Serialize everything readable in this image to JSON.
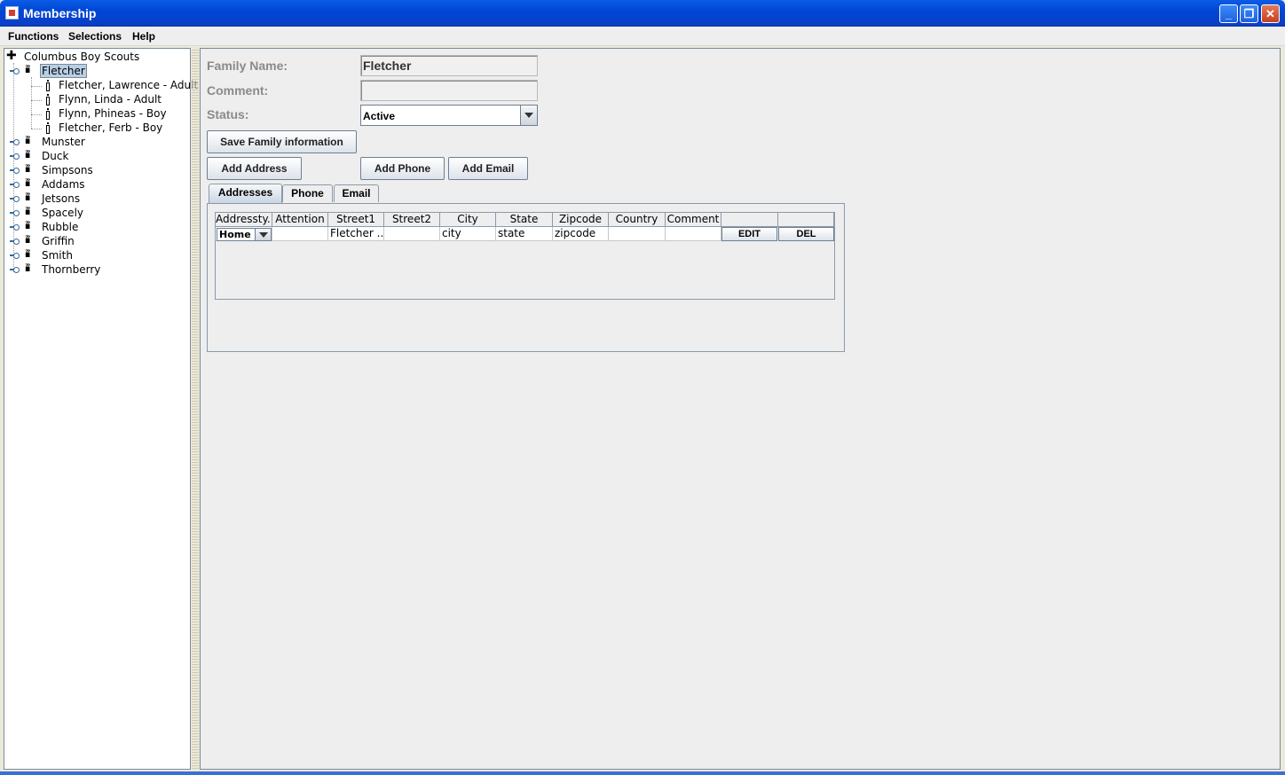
{
  "window": {
    "title": "Membership"
  },
  "menu": {
    "functions": "Functions",
    "selections": "Selections",
    "help": "Help"
  },
  "tree": {
    "root": "Columbus Boy Scouts",
    "selected_family": "Fletcher",
    "members": [
      "Fletcher, Lawrence  - Adult",
      "Flynn, Linda  - Adult",
      "Flynn, Phineas  - Boy",
      "Fletcher, Ferb  - Boy"
    ],
    "families": [
      "Munster",
      "Duck",
      "Simpsons",
      "Addams",
      "Jetsons",
      "Spacely",
      "Rubble",
      "Griffin",
      "Smith",
      "Thornberry"
    ]
  },
  "form": {
    "family_name_label": "Family Name:",
    "family_name_value": "Fletcher",
    "comment_label": "Comment:",
    "comment_value": "",
    "status_label": "Status:",
    "status_value": "Active"
  },
  "buttons": {
    "save_family": "Save Family information",
    "add_address": "Add Address",
    "add_phone": "Add Phone",
    "add_email": "Add Email"
  },
  "tabs": [
    "Addresses",
    "Phone",
    "Email"
  ],
  "table": {
    "columns": [
      "Addressty...",
      "Attention",
      "Street1",
      "Street2",
      "City",
      "State",
      "Zipcode",
      "Country",
      "Comment",
      "",
      ""
    ],
    "rows": [
      {
        "address_type": "Home",
        "attention": "",
        "street1": "Fletcher ...",
        "street2": "",
        "city": "city",
        "state": "state",
        "zipcode": "zipcode",
        "country": "",
        "comment": "",
        "edit": "EDIT",
        "del": "DEL"
      }
    ]
  },
  "icons": {
    "tree_root": "tree-root-icon",
    "family": "family-icon",
    "person": "person-icon",
    "expand": "expand-handle-icon"
  },
  "colors": {
    "titlebar": "#0046d5",
    "selection": "#b8cfe5",
    "panel": "#eeeeee"
  }
}
